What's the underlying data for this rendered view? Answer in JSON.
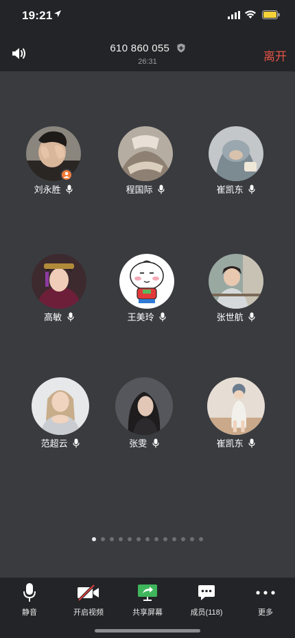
{
  "status_bar": {
    "time": "19:21"
  },
  "call": {
    "meeting_id": "610 860 055",
    "duration": "26:31",
    "leave_label": "离开"
  },
  "participants": [
    {
      "name": "刘永胜",
      "host": true,
      "avatar": "person-covering-face"
    },
    {
      "name": "程国际",
      "avatar": "person-arms-crossed"
    },
    {
      "name": "崔凯东",
      "avatar": "person-hooded"
    },
    {
      "name": "高敏",
      "avatar": "woman-costume"
    },
    {
      "name": "王美玲",
      "avatar": "cartoon-bun"
    },
    {
      "name": "张世航",
      "avatar": "girl-by-window"
    },
    {
      "name": "范超云",
      "avatar": "woman-blonde"
    },
    {
      "name": "张雯",
      "avatar": "woman-dark-hair"
    },
    {
      "name": "崔凯东",
      "avatar": "child-standing"
    }
  ],
  "pagination": {
    "total": 13,
    "active": 0
  },
  "toolbar": {
    "mute": "静音",
    "video": "开启视频",
    "share": "共享屏幕",
    "members": "成员(118)",
    "more": "更多"
  },
  "colors": {
    "leave": "#e25447",
    "host_badge": "#f07c38",
    "share_icon": "#3fb55c",
    "video_off_slash": "#e04040"
  }
}
